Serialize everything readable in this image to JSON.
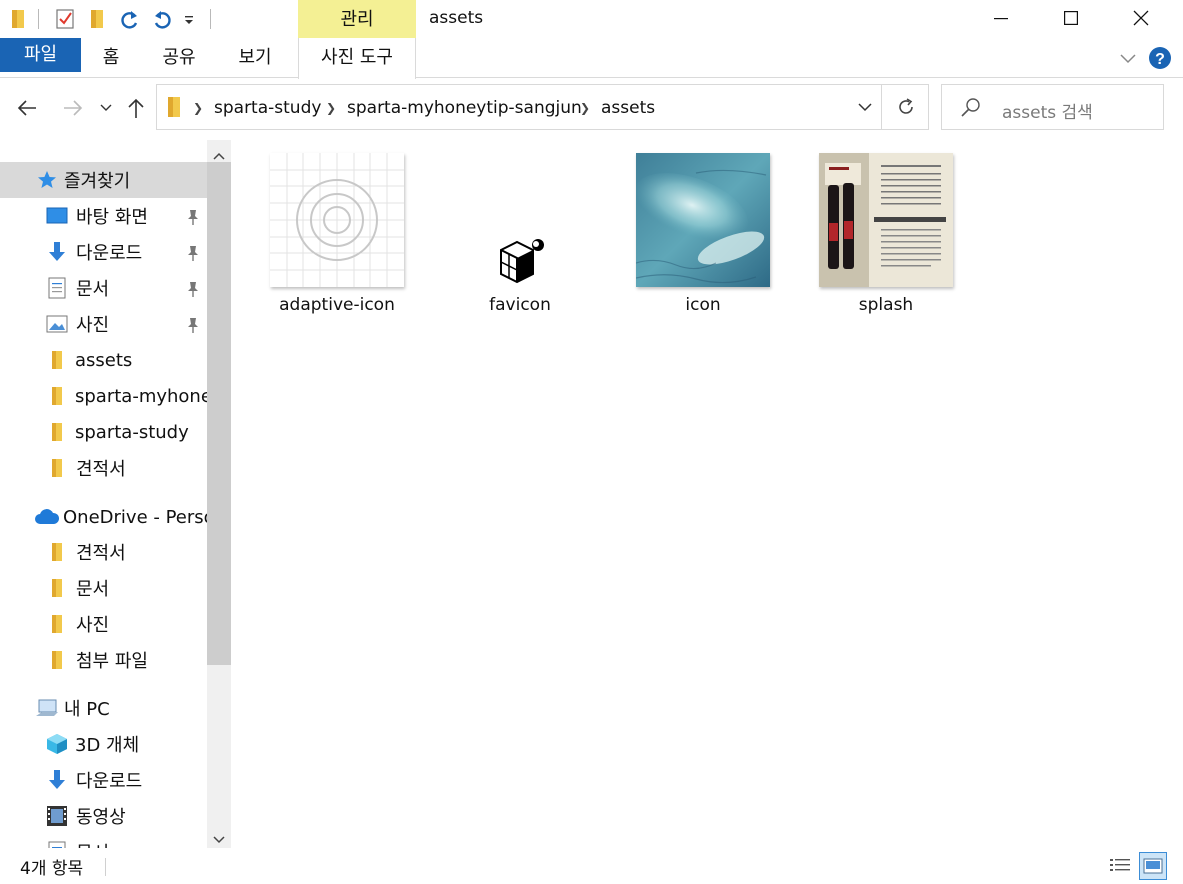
{
  "window": {
    "title": "assets",
    "context_tab_group": "관리"
  },
  "ribbon": {
    "tabs": [
      "파일",
      "홈",
      "공유",
      "보기",
      "사진 도구"
    ]
  },
  "address": {
    "crumbs": [
      "sparta-study",
      "sparta-myhoneytip-sangjun",
      "assets"
    ]
  },
  "search": {
    "placeholder": "assets 검색"
  },
  "sidebar": {
    "quick_access": "즐겨찾기",
    "quick_items": [
      "바탕 화면",
      "다운로드",
      "문서",
      "사진",
      "assets",
      "sparta-myhoney",
      "sparta-study",
      "견적서"
    ],
    "onedrive": "OneDrive - Persor",
    "onedrive_items": [
      "견적서",
      "문서",
      "사진",
      "첨부 파일"
    ],
    "this_pc": "내 PC",
    "pc_items": [
      "3D 개체",
      "다운로드",
      "동영상",
      "문서"
    ]
  },
  "files": [
    {
      "name": "adaptive-icon"
    },
    {
      "name": "favicon"
    },
    {
      "name": "icon"
    },
    {
      "name": "splash"
    }
  ],
  "status": {
    "item_count": "4개 항목"
  },
  "colors": {
    "file_tab": "#1a64b4",
    "context_tab": "#f4f094",
    "selected_nav": "#d9d9d9"
  }
}
